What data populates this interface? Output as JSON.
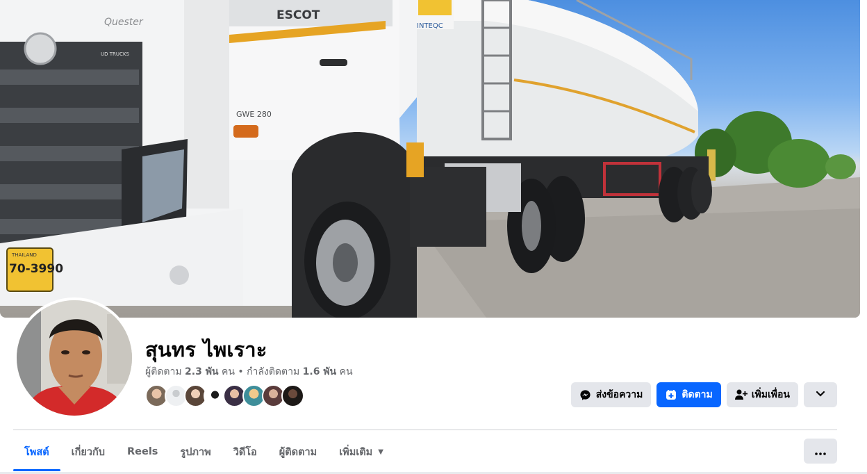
{
  "profile": {
    "name": "สุนทร ไพเราะ",
    "followers_label": "ผู้ติดตาม",
    "followers_count": "2.3 พัน",
    "followers_unit": "คน",
    "separator": "•",
    "following_label": "กำลังติดตาม",
    "following_count": "1.6 พัน",
    "following_unit": "คน"
  },
  "cover": {
    "plate_top": "THAILAND",
    "plate_number": "70-3990",
    "truck_brand": "ESCOT",
    "truck_model": "Quester",
    "badge": "UD TRUCKS",
    "engine": "GWE 280",
    "trailer_brand": "INTEQC"
  },
  "actions": {
    "message_label": "ส่งข้อความ",
    "follow_label": "ติดตาม",
    "add_friend_label": "เพิ่มเพื่อน"
  },
  "tabs": [
    {
      "label": "โพสต์",
      "active": true
    },
    {
      "label": "เกี่ยวกับ"
    },
    {
      "label": "Reels"
    },
    {
      "label": "รูปภาพ"
    },
    {
      "label": "วิดีโอ"
    },
    {
      "label": "ผู้ติดตาม"
    },
    {
      "label": "เพิ่มเติม"
    }
  ],
  "colors": {
    "accent": "#0866ff",
    "button_bg": "#e4e6eb",
    "secondary_text": "#65676b"
  },
  "icons": [
    "messenger-icon",
    "follow-icon",
    "add-friend-icon",
    "chevron-down-icon",
    "more-dots-icon"
  ]
}
